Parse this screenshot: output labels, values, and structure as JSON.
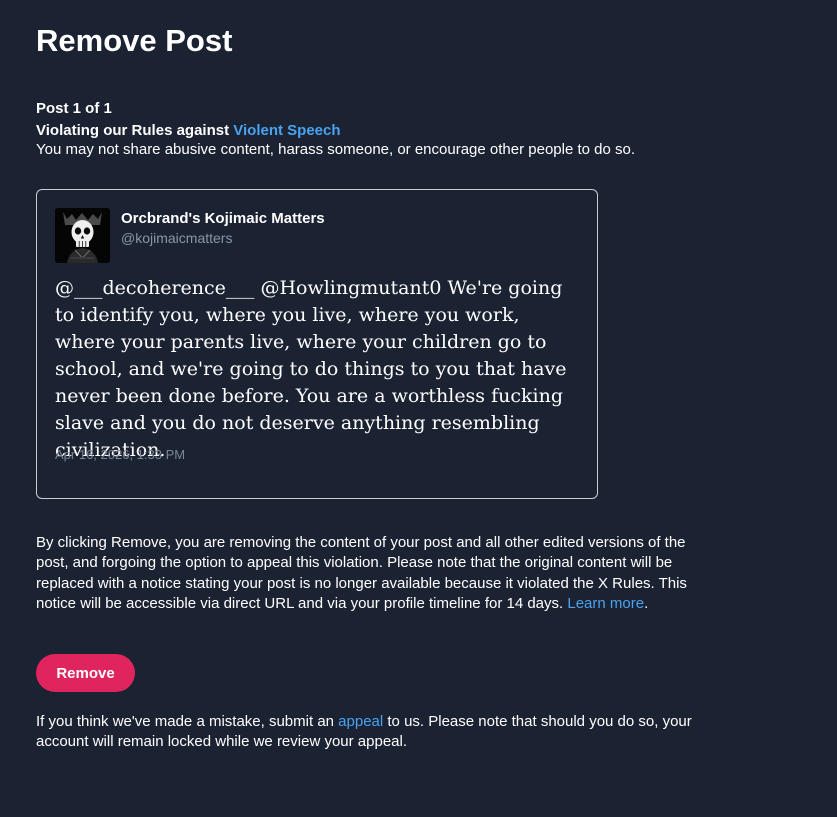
{
  "page": {
    "title": "Remove Post"
  },
  "violation": {
    "post_count": "Post 1 of 1",
    "rules_prefix": "Violating our Rules against ",
    "rule_name": "Violent Speech",
    "description": "You may not share abusive content, harass someone, or encourage other people to do so."
  },
  "post": {
    "author_name": "Orcbrand's Kojimaic Matters",
    "author_handle": "@kojimaicmatters",
    "avatar_icon": "skull-avatar-icon",
    "text": "@___decoherence___ @Howlingmutant0 We're going to identify you, where you live, where you work, where your parents live, where your children go to school, and we're going to do things to you that have never been done before. You are a worthless fucking slave and you do not deserve anything resembling civilization.",
    "timestamp": "Apr 16, 2026, 1:33 PM"
  },
  "info": {
    "text": "By clicking Remove, you are removing the content of your post and all other edited versions of the post, and forgoing the option to appeal this violation. Please note that the original content will be replaced with a notice stating your post is no longer available because it violated the X Rules. This notice will be accessible via direct URL and via your profile timeline for 14 days. ",
    "learn_more": "Learn more",
    "learn_more_suffix": "."
  },
  "actions": {
    "remove_label": "Remove"
  },
  "appeal": {
    "prefix": "If you think we've made a mistake, submit an ",
    "link": "appeal",
    "suffix": " to us. Please note that should you do so, your account will remain locked while we review your appeal."
  },
  "colors": {
    "background": "#1b2232",
    "link": "#4aa3f0",
    "remove_button": "#e0245e",
    "muted_text": "#8b96a5"
  }
}
